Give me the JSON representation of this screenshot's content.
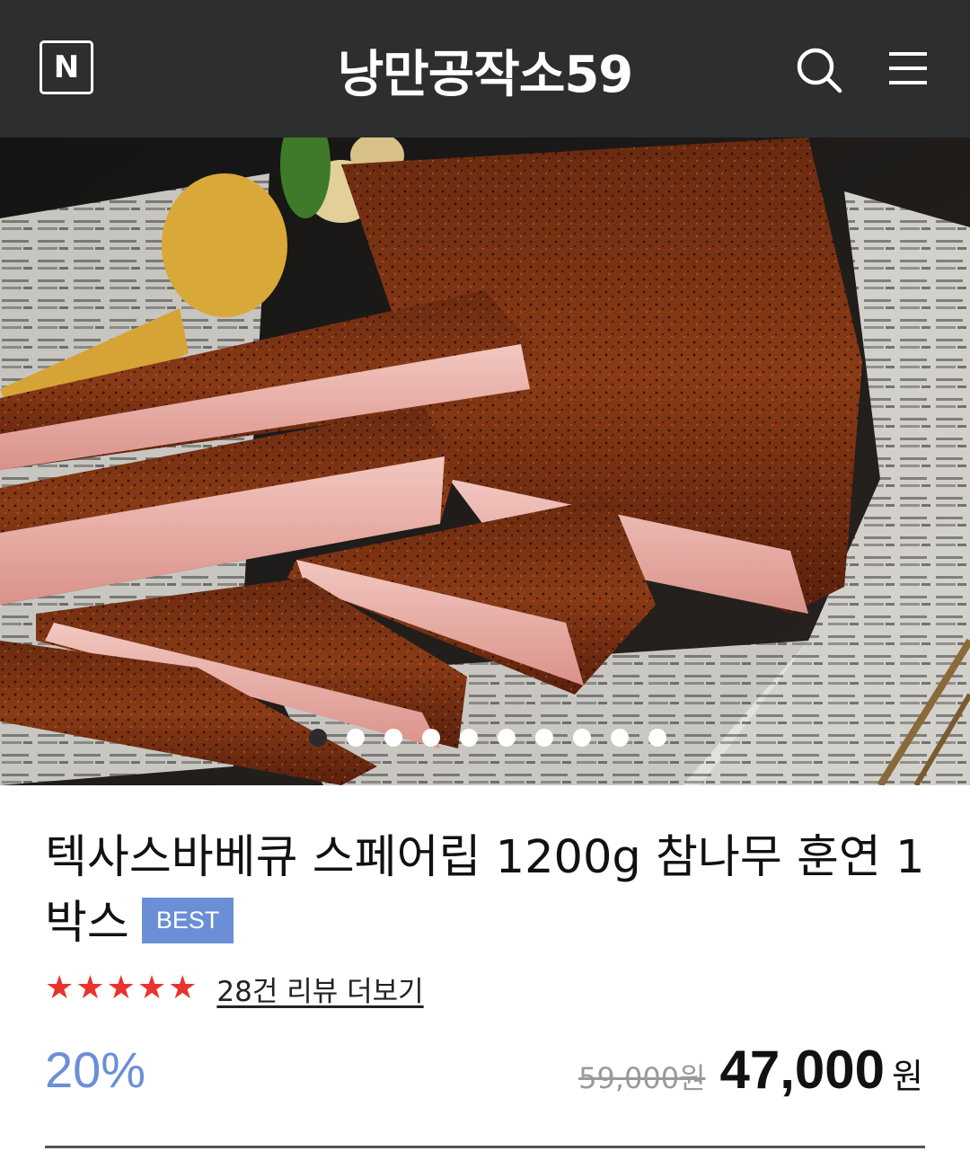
{
  "header": {
    "logo_letter": "N",
    "title": "낭만공작소59",
    "search_icon": "search-icon",
    "menu_icon": "hamburger-menu-icon"
  },
  "carousel": {
    "slide_count": 10,
    "active_index": 0
  },
  "product": {
    "title": "텍사스바베큐 스페어립 1200g 참나무 훈연 1박스",
    "badge": "BEST",
    "rating": 5,
    "review_link": "28건 리뷰 더보기",
    "discount": "20%",
    "original_price": "59,000원",
    "sale_price": "47,000",
    "currency": "원"
  },
  "colors": {
    "header_bg": "#2d2e30",
    "accent_blue": "#6b8fd6",
    "star_red": "#e8342c"
  }
}
